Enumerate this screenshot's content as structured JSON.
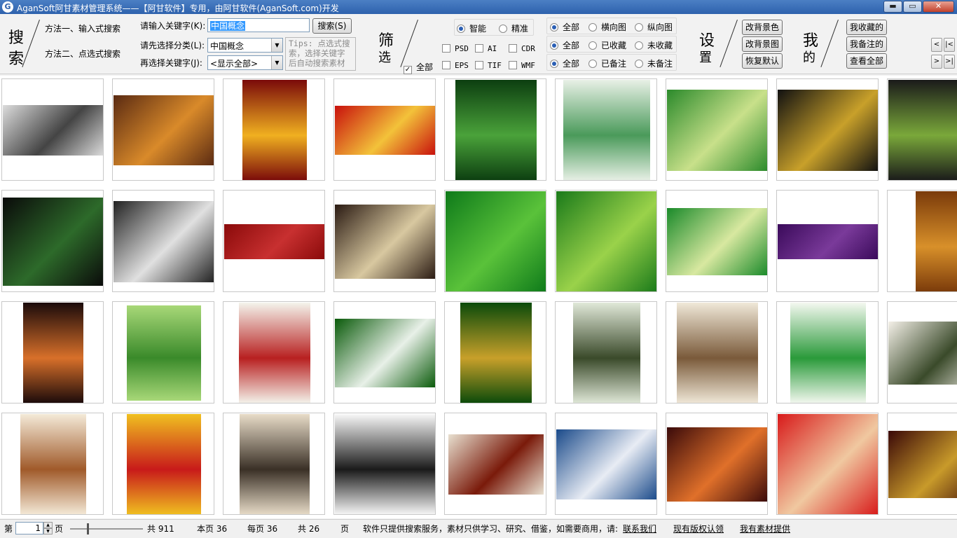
{
  "window": {
    "title": "AganSoft阿甘素材管理系统——【阿甘软件】专用，由阿甘软件(AganSoft.com)开发",
    "icon_letter": "G",
    "controls": {
      "minimize": "▬",
      "maximize": "▭",
      "close": "✕"
    }
  },
  "search": {
    "heading_1": "搜",
    "heading_2": "索",
    "method1": "方法一、输入式搜索",
    "method2": "方法二、点选式搜索",
    "keyword_label": "请输入关键字(K):",
    "keyword_value": "中国概念",
    "search_button": "搜索(S)",
    "category_label": "请先选择分类(L):",
    "category_value": "中国概念",
    "subkey_label": "再选择关键字(J):",
    "subkey_value": "<显示全部>",
    "tips_1": "Tips: 点选式搜",
    "tips_2": "索，选择关键字",
    "tips_3": "后自动搜索素材"
  },
  "filter": {
    "heading_1": "筛",
    "heading_2": "选",
    "mode": [
      {
        "label": "智能",
        "on": true
      },
      {
        "label": "精准",
        "on": false
      }
    ],
    "formats": [
      {
        "label": "PSD",
        "on": false
      },
      {
        "label": "AI",
        "on": false
      },
      {
        "label": "CDR",
        "on": false
      },
      {
        "label": "EPS",
        "on": false
      },
      {
        "label": "TIF",
        "on": false
      },
      {
        "label": "WMF",
        "on": false
      }
    ],
    "all_check": {
      "label": "全部",
      "on": true
    },
    "orientation": [
      {
        "label": "全部",
        "on": true
      },
      {
        "label": "横向图",
        "on": false
      },
      {
        "label": "纵向图",
        "on": false
      }
    ],
    "favorite": [
      {
        "label": "全部",
        "on": true
      },
      {
        "label": "已收藏",
        "on": false
      },
      {
        "label": "未收藏",
        "on": false
      }
    ],
    "note": [
      {
        "label": "全部",
        "on": true
      },
      {
        "label": "已备注",
        "on": false
      },
      {
        "label": "未备注",
        "on": false
      }
    ]
  },
  "settings": {
    "heading_1": "设",
    "heading_2": "置",
    "bg_color": "改背景色",
    "bg_image": "改背景图",
    "reset": "恢复默认"
  },
  "mine": {
    "heading_1": "我",
    "heading_2": "的",
    "favorites": "我收藏的",
    "noted": "我备注的",
    "all": "查看全部"
  },
  "pager_nav": {
    "prev": "<",
    "first": "|<",
    "next": ">",
    "last": ">|"
  },
  "thumbnails": [
    {
      "name": "watertown",
      "c1": "#dcdcdc",
      "c2": "#444444",
      "orient": "h",
      "w": 144,
      "h": 72
    },
    {
      "name": "palace",
      "c1": "#5a2a12",
      "c2": "#d98a2a",
      "orient": "h",
      "w": 144,
      "h": 100
    },
    {
      "name": "dragon-poster",
      "c1": "#7a0a0a",
      "c2": "#f0b020",
      "orient": "v",
      "w": 92,
      "h": 144
    },
    {
      "name": "red-banner",
      "c1": "#c8100c",
      "c2": "#f3c23a",
      "orient": "h",
      "w": 144,
      "h": 70
    },
    {
      "name": "green-tea",
      "c1": "#0c3e10",
      "c2": "#4aa23a",
      "orient": "v",
      "w": 116,
      "h": 144
    },
    {
      "name": "lotus-tea",
      "c1": "#e8f0e6",
      "c2": "#4a9a5a",
      "orient": "v",
      "w": 124,
      "h": 144
    },
    {
      "name": "xihu-longjing",
      "c1": "#2b8a2b",
      "c2": "#c8e08a",
      "orient": "h",
      "w": 144,
      "h": 116
    },
    {
      "name": "gold-box",
      "c1": "#111111",
      "c2": "#c8a02a",
      "orient": "h",
      "w": 144,
      "h": 116
    },
    {
      "name": "tea-cans",
      "c1": "#1a1a1a",
      "c2": "#7aa83a",
      "orient": "v",
      "w": 144,
      "h": 144
    },
    {
      "name": "black-box",
      "c1": "#0a0a0a",
      "c2": "#2d6a2a",
      "orient": "h",
      "w": 144,
      "h": 126
    },
    {
      "name": "package-design",
      "c1": "#222222",
      "c2": "#e0e0e0",
      "orient": "h",
      "w": 144,
      "h": 116
    },
    {
      "name": "red-strip",
      "c1": "#8a0a0a",
      "c2": "#c83030",
      "orient": "h",
      "w": 144,
      "h": 50
    },
    {
      "name": "dark-menu",
      "c1": "#2a1a12",
      "c2": "#d8c8a0",
      "orient": "h",
      "w": 144,
      "h": 106
    },
    {
      "name": "green-pattern",
      "c1": "#0e7a1a",
      "c2": "#5ac23a",
      "orient": "h",
      "w": 144,
      "h": 144
    },
    {
      "name": "gourd-tea",
      "c1": "#1a7a1a",
      "c2": "#9ad24a",
      "orient": "h",
      "w": 144,
      "h": 144
    },
    {
      "name": "green-landscape",
      "c1": "#1a8a2a",
      "c2": "#d8e8a0",
      "orient": "h",
      "w": 144,
      "h": 96
    },
    {
      "name": "purple-strip",
      "c1": "#3a0a5a",
      "c2": "#7a3a9a",
      "orient": "h",
      "w": 144,
      "h": 50
    },
    {
      "name": "bronze-tall",
      "c1": "#7a3a0a",
      "c2": "#d8902a",
      "orient": "v",
      "w": 66,
      "h": 144
    },
    {
      "name": "dragon-emblem",
      "c1": "#1a0a0a",
      "c2": "#d8702a",
      "orient": "v",
      "w": 86,
      "h": 144
    },
    {
      "name": "fresh-tea",
      "c1": "#a8d878",
      "c2": "#3a8a2a",
      "orient": "v",
      "w": 106,
      "h": 136
    },
    {
      "name": "white-tea",
      "c1": "#f4f4ec",
      "c2": "#b82020",
      "orient": "v",
      "w": 102,
      "h": 144
    },
    {
      "name": "green-cloud",
      "c1": "#0a5a0a",
      "c2": "#e8f0e8",
      "orient": "h",
      "w": 144,
      "h": 98
    },
    {
      "name": "tea-way",
      "c1": "#0a4a0a",
      "c2": "#c8a02a",
      "orient": "v",
      "w": 102,
      "h": 144
    },
    {
      "name": "bamboo-man",
      "c1": "#e0e8d8",
      "c2": "#3a4a2a",
      "orient": "v",
      "w": 96,
      "h": 144
    },
    {
      "name": "teapot-sepia",
      "c1": "#f0e8d8",
      "c2": "#7a5a3a",
      "orient": "v",
      "w": 116,
      "h": 144
    },
    {
      "name": "green-board",
      "c1": "#f4f8f0",
      "c2": "#2a9a3a",
      "orient": "v",
      "w": 108,
      "h": 144
    },
    {
      "name": "roof-tea",
      "c1": "#f4f0e8",
      "c2": "#3a4a2a",
      "orient": "h",
      "w": 144,
      "h": 90
    },
    {
      "name": "teapot-beige",
      "c1": "#f4ead8",
      "c2": "#a05a2a",
      "orient": "v",
      "w": 94,
      "h": 144
    },
    {
      "name": "chinese-knot",
      "c1": "#f0c020",
      "c2": "#c81a1a",
      "orient": "v",
      "w": 106,
      "h": 144
    },
    {
      "name": "ink-scroll",
      "c1": "#e8dcc8",
      "c2": "#3a3026",
      "orient": "v",
      "w": 100,
      "h": 144
    },
    {
      "name": "ink-circle",
      "c1": "#f8f8f8",
      "c2": "#1a1a1a",
      "orient": "v",
      "w": 144,
      "h": 144
    },
    {
      "name": "tea-cup",
      "c1": "#e8e0d0",
      "c2": "#7a1a0a",
      "orient": "h",
      "w": 136,
      "h": 86
    },
    {
      "name": "city-lady",
      "c1": "#1a4a8a",
      "c2": "#e8ecf4",
      "orient": "h",
      "w": 144,
      "h": 100
    },
    {
      "name": "red-sky",
      "c1": "#3a0a0a",
      "c2": "#e0702a",
      "orient": "h",
      "w": 144,
      "h": 106
    },
    {
      "name": "red-dragon",
      "c1": "#d81a1a",
      "c2": "#f0c8a0",
      "orient": "h",
      "w": 144,
      "h": 144
    },
    {
      "name": "dark-red-roof",
      "c1": "#3a0808",
      "c2": "#c89a2a",
      "orient": "h",
      "w": 144,
      "h": 96
    }
  ],
  "status": {
    "page_prefix": "第",
    "page_value": "1",
    "page_suffix": "页",
    "total": "共 911",
    "this_page": "本页 36",
    "per_page": "每页 36",
    "pages": "共 26",
    "pages_unit": "页",
    "notice": "软件只提供搜索服务，素材只供学习、研究、借鉴，如需要商用，请: ",
    "contact": "联系我们",
    "copyright": "现有版权认领",
    "submit": "我有素材提供"
  }
}
